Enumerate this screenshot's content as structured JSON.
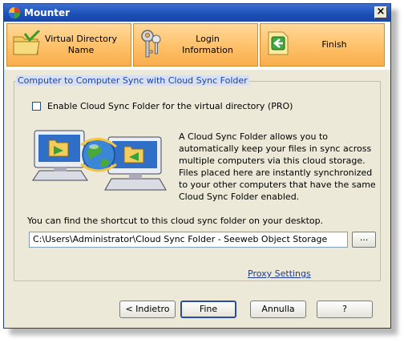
{
  "window": {
    "title": "Mounter",
    "close_label": "×"
  },
  "wizard": {
    "steps": [
      {
        "label": "Virtual Directory\nName",
        "icon": "folder-checked-icon"
      },
      {
        "label": "Login\nInformation",
        "icon": "keys-icon"
      },
      {
        "label": "Finish",
        "icon": "finish-arrow-icon"
      }
    ]
  },
  "group": {
    "title": "Computer to Computer Sync with Cloud Sync Folder"
  },
  "enable_checkbox": {
    "label": "Enable Cloud Sync Folder for the virtual directory (PRO)",
    "checked": false
  },
  "description": "A Cloud Sync Folder allows you to automatically keep your files in sync across multiple computers via this cloud storage. Files placed here are instantly synchronized to your other computers that have the same Cloud Sync Folder enabled.",
  "shortcut_note": "You can find the shortcut to this cloud sync folder on your desktop.",
  "path": {
    "value": "C:\\Users\\Administrator\\Cloud Sync Folder - Seeweb Object Storage"
  },
  "browse_label": "...",
  "proxy_link": "Proxy Settings",
  "buttons": {
    "back": "< Indietro",
    "finish": "Fine",
    "cancel": "Annulla",
    "help": "?"
  },
  "colors": {
    "titlebar": "#1b4fb6",
    "step_fill": "#ffc068",
    "group_title": "#1945a8",
    "link": "#1f3a8a"
  }
}
